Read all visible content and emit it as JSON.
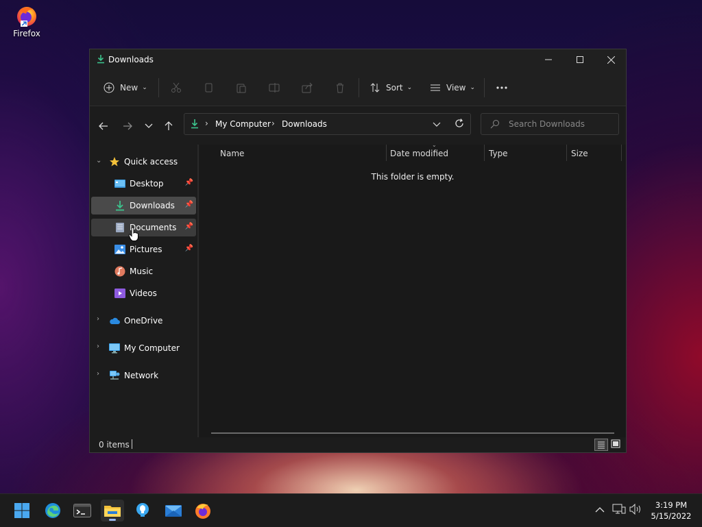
{
  "desktop": {
    "icons": [
      {
        "label": "Firefox",
        "icon": "firefox-icon"
      }
    ]
  },
  "window": {
    "title": "Downloads",
    "toolbar": {
      "new_label": "New",
      "sort_label": "Sort",
      "view_label": "View",
      "more_icon": "more-icon"
    },
    "address": {
      "crumbs": [
        "My Computer",
        "Downloads"
      ]
    },
    "search": {
      "placeholder": "Search Downloads"
    },
    "sidebar": {
      "quick_access": "Quick access",
      "pinned": [
        {
          "label": "Desktop",
          "icon": "desktop-folder-icon"
        },
        {
          "label": "Downloads",
          "icon": "download-icon"
        },
        {
          "label": "Documents",
          "icon": "documents-icon"
        },
        {
          "label": "Pictures",
          "icon": "pictures-icon"
        },
        {
          "label": "Music",
          "icon": "music-icon"
        },
        {
          "label": "Videos",
          "icon": "videos-icon"
        }
      ],
      "onedrive": "OneDrive",
      "my_computer": "My Computer",
      "network": "Network"
    },
    "columns": {
      "name": "Name",
      "date_modified": "Date modified",
      "type": "Type",
      "size": "Size"
    },
    "empty_message": "This folder is empty.",
    "status": {
      "items": "0 items"
    },
    "colors": {
      "accent_green": "#3cc48d",
      "folder_yellow": "#f3c13a",
      "selected_bg": "#4a4a4a"
    }
  },
  "taskbar": {
    "clock": {
      "time": "3:19 PM",
      "date": "5/15/2022"
    },
    "apps": [
      "start-icon",
      "edge-icon",
      "terminal-icon",
      "file-explorer-icon",
      "tips-icon",
      "mail-icon",
      "firefox-icon"
    ]
  }
}
